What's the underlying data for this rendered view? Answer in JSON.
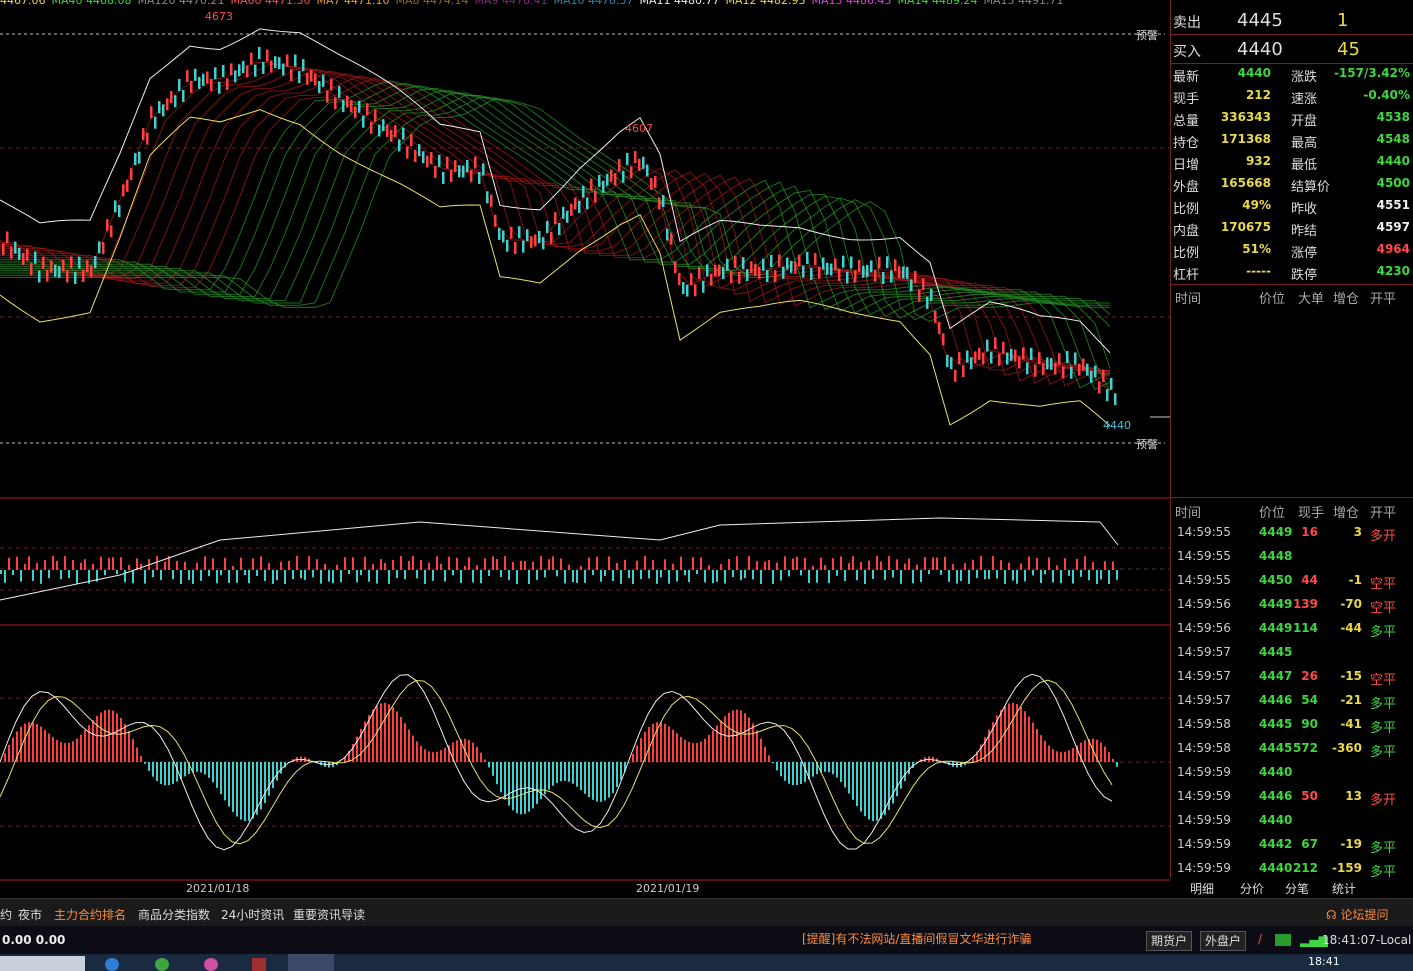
{
  "ma_legend": [
    {
      "text": "4467.06",
      "color": "#e8d94a"
    },
    {
      "text": "MA40 4468.08",
      "color": "#3fd63f"
    },
    {
      "text": "MA120 4470.21",
      "color": "#888888"
    },
    {
      "text": "MA60 4471.30",
      "color": "#ff4a4a"
    },
    {
      "text": "MA7 4471.10",
      "color": "#e8a020"
    },
    {
      "text": "MA8 4474.14",
      "color": "#8b6b2e"
    },
    {
      "text": "MA9 4476.41",
      "color": "#7a2e7a"
    },
    {
      "text": "MA10 4478.37",
      "color": "#2e8aa0"
    },
    {
      "text": "MA11 4480.77",
      "color": "#eeeeee"
    },
    {
      "text": "MA12 4482.93",
      "color": "#e8d94a"
    },
    {
      "text": "MA13 4486.43",
      "color": "#e040e0"
    },
    {
      "text": "MA14 4489.24",
      "color": "#3fd63f"
    },
    {
      "text": "MA15 4491.71",
      "color": "#888888"
    }
  ],
  "chart": {
    "high_label": "4673",
    "mid_high_label": "4607",
    "last_label": "4440",
    "alert_top": "预警",
    "alert_bottom": "预警",
    "date1": "2021/01/18",
    "date2": "2021/01/19"
  },
  "orderbook": {
    "sell_label": "卖出",
    "sell_price": "4445",
    "sell_vol": "1",
    "buy_label": "买入",
    "buy_price": "4440",
    "buy_vol": "45"
  },
  "stats": [
    {
      "k1": "最新",
      "v1": "4440",
      "c1": "grn",
      "k2": "涨跌",
      "v2": "-157/3.42%",
      "c2": "grn"
    },
    {
      "k1": "现手",
      "v1": "212",
      "c1": "yel",
      "k2": "速涨",
      "v2": "-0.40%",
      "c2": "grn"
    },
    {
      "k1": "总量",
      "v1": "336343",
      "c1": "yel",
      "k2": "开盘",
      "v2": "4538",
      "c2": "grn"
    },
    {
      "k1": "持仓",
      "v1": "171368",
      "c1": "yel",
      "k2": "最高",
      "v2": "4548",
      "c2": "grn"
    },
    {
      "k1": "日增",
      "v1": "932",
      "c1": "yel",
      "k2": "最低",
      "v2": "4440",
      "c2": "grn"
    },
    {
      "k1": "外盘",
      "v1": "165668",
      "c1": "yel",
      "k2": "结算价",
      "v2": "4500",
      "c2": "grn"
    },
    {
      "k1": "比例",
      "v1": "49%",
      "c1": "yel",
      "k2": "昨收",
      "v2": "4551",
      "c2": "wht"
    },
    {
      "k1": "内盘",
      "v1": "170675",
      "c1": "yel",
      "k2": "昨结",
      "v2": "4597",
      "c2": "wht"
    },
    {
      "k1": "比例",
      "v1": "51%",
      "c1": "yel",
      "k2": "涨停",
      "v2": "4964",
      "c2": "red"
    },
    {
      "k1": "杠杆",
      "v1": "-----",
      "c1": "yel",
      "k2": "跌停",
      "v2": "4230",
      "c2": "grn"
    }
  ],
  "big_header": {
    "time": "时间",
    "price": "价位",
    "big": "大单",
    "oi": "增仓",
    "type": "开平"
  },
  "tick_header": {
    "time": "时间",
    "price": "价位",
    "vol": "现手",
    "oi": "增仓",
    "type": "开平"
  },
  "ticks": [
    {
      "time": "14:59:55",
      "price": "4449",
      "vol": "16",
      "oi": "3",
      "type": "多开",
      "vc": "red",
      "oc": "yel"
    },
    {
      "time": "14:59:55",
      "price": "4448",
      "vol": "",
      "oi": "",
      "type": "",
      "vc": "red",
      "oc": "yel"
    },
    {
      "time": "14:59:55",
      "price": "4450",
      "vol": "44",
      "oi": "-1",
      "type": "空平",
      "vc": "red",
      "oc": "yel"
    },
    {
      "time": "14:59:56",
      "price": "4449",
      "vol": "139",
      "oi": "-70",
      "type": "空平",
      "vc": "red",
      "oc": "yel"
    },
    {
      "time": "14:59:56",
      "price": "4449",
      "vol": "114",
      "oi": "-44",
      "type": "多平",
      "vc": "grn",
      "oc": "yel"
    },
    {
      "time": "14:59:57",
      "price": "4445",
      "vol": "",
      "oi": "",
      "type": "",
      "vc": "grn",
      "oc": "yel"
    },
    {
      "time": "14:59:57",
      "price": "4447",
      "vol": "26",
      "oi": "-15",
      "type": "空平",
      "vc": "red",
      "oc": "yel"
    },
    {
      "time": "14:59:57",
      "price": "4446",
      "vol": "54",
      "oi": "-21",
      "type": "多平",
      "vc": "grn",
      "oc": "yel"
    },
    {
      "time": "14:59:58",
      "price": "4445",
      "vol": "90",
      "oi": "-41",
      "type": "多平",
      "vc": "grn",
      "oc": "yel"
    },
    {
      "time": "14:59:58",
      "price": "4445",
      "vol": "572",
      "oi": "-360",
      "type": "多平",
      "vc": "grn",
      "oc": "yel"
    },
    {
      "time": "14:59:59",
      "price": "4440",
      "vol": "",
      "oi": "",
      "type": "",
      "vc": "grn",
      "oc": "yel"
    },
    {
      "time": "14:59:59",
      "price": "4446",
      "vol": "50",
      "oi": "13",
      "type": "多开",
      "vc": "red",
      "oc": "yel"
    },
    {
      "time": "14:59:59",
      "price": "4440",
      "vol": "",
      "oi": "",
      "type": "",
      "vc": "grn",
      "oc": "yel"
    },
    {
      "time": "14:59:59",
      "price": "4442",
      "vol": "67",
      "oi": "-19",
      "type": "多平",
      "vc": "grn",
      "oc": "yel"
    },
    {
      "time": "14:59:59",
      "price": "4440",
      "vol": "212",
      "oi": "-159",
      "type": "多平",
      "vc": "grn",
      "oc": "yel"
    }
  ],
  "side_tabs": [
    "明细",
    "分价",
    "分笔",
    "统计"
  ],
  "bottom_tabs": [
    "约",
    "夜市",
    "主力合约排名",
    "商品分类指数",
    "24小时资讯",
    "重要资讯导读"
  ],
  "forum": "论坛提问",
  "status": {
    "values": "0.00  0.00",
    "notice": "[提醒]有不法网站/直播间假冒文华进行诈骗",
    "btn1": "期货户",
    "btn2": "外盘户",
    "clock": "18:41:07-Local"
  },
  "taskbar_time": "18:41"
}
